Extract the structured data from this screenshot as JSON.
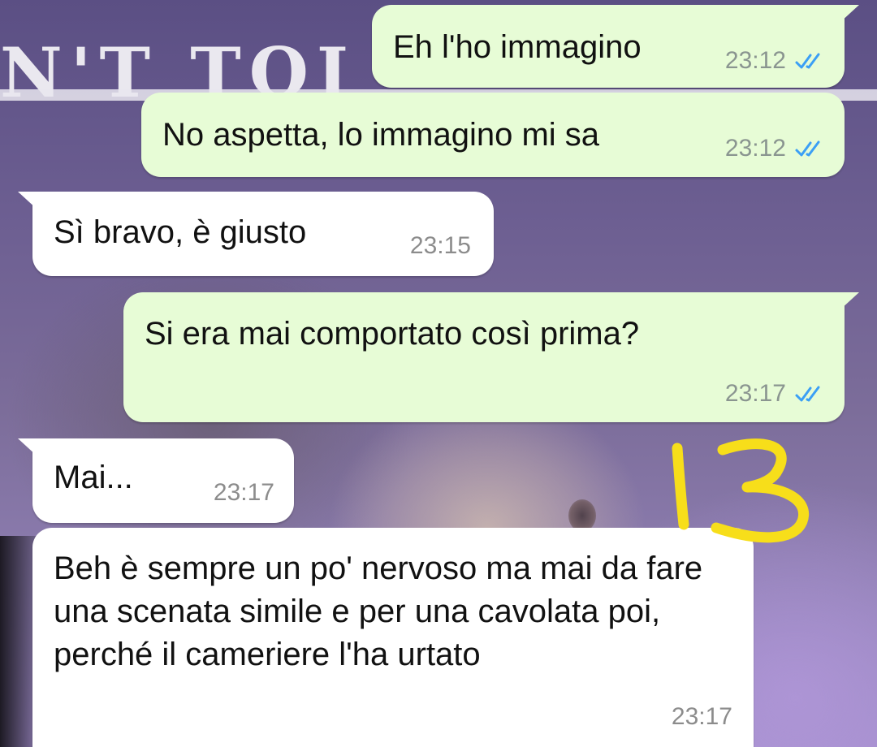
{
  "background": {
    "banner_text": "N'T TOI"
  },
  "annotation": {
    "label": "13",
    "color": "#f7de1a"
  },
  "colors": {
    "outgoing_bubble": "#e7fcd6",
    "incoming_bubble": "#ffffff",
    "read_ticks": "#3b9ff5"
  },
  "messages": [
    {
      "direction": "outgoing",
      "text": "Eh l'ho immagino",
      "time": "23:12",
      "status_icon": "double-check-read-icon"
    },
    {
      "direction": "outgoing",
      "text": "No aspetta, lo immagino mi sa",
      "time": "23:12",
      "status_icon": "double-check-read-icon"
    },
    {
      "direction": "incoming",
      "text": "Sì bravo, è giusto",
      "time": "23:15"
    },
    {
      "direction": "outgoing",
      "text": "Si era mai comportato così prima?",
      "time": "23:17",
      "status_icon": "double-check-read-icon"
    },
    {
      "direction": "incoming",
      "text": "Mai...",
      "time": "23:17"
    },
    {
      "direction": "incoming",
      "text": "Beh è sempre un po' nervoso ma mai da fare una scenata simile e per una cavolata poi, perché il cameriere l'ha urtato",
      "time": "23:17"
    }
  ]
}
